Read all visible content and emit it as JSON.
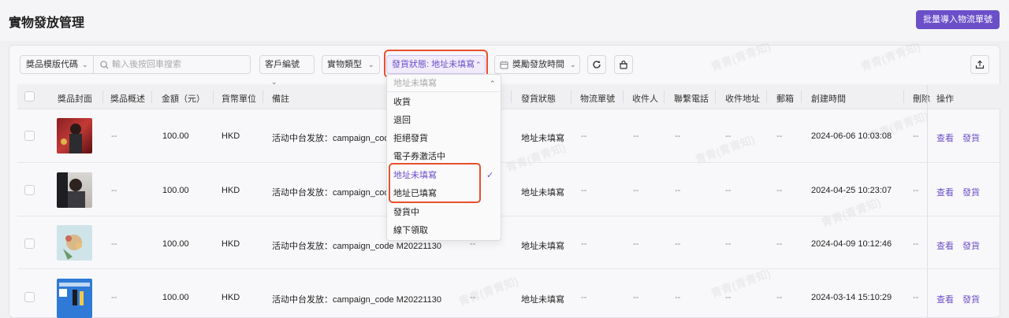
{
  "page": {
    "title": "實物發放管理",
    "batch_button": "批量導入物流單號"
  },
  "filters": {
    "search_field": "獎品模版代碼",
    "search_placeholder": "輸入後按回車搜索",
    "customer_code": "客戶編號",
    "item_type": "實物類型",
    "status": "發貨狀態: 地址未填寫",
    "reward_time": "獎勵發放時間"
  },
  "columns": [
    "獎品封面",
    "獎品概述",
    "金額（元）",
    "貨幣單位",
    "備註",
    "發貨狀態",
    "物流單號",
    "收件人",
    "聯繫電話",
    "收件地址",
    "郵箱",
    "創建時間",
    "刪除",
    "操作"
  ],
  "rows": [
    {
      "summary": "--",
      "amount": "100.00",
      "currency": "HKD",
      "remark": "活动中台发放：campaign_code",
      "status": "地址未填寫",
      "tracking": "--",
      "recipient": "--",
      "phone": "--",
      "address": "--",
      "email": "--",
      "created": "2024-06-06 10:03:08",
      "deleted": "--",
      "view": "查看",
      "ship": "發貨"
    },
    {
      "summary": "--",
      "amount": "100.00",
      "currency": "HKD",
      "remark": "活动中台发放：campaign_code",
      "status": "地址未填寫",
      "tracking": "--",
      "recipient": "--",
      "phone": "--",
      "address": "--",
      "email": "--",
      "created": "2024-04-25 10:23:07",
      "deleted": "--",
      "view": "查看",
      "ship": "發貨"
    },
    {
      "summary": "--",
      "amount": "100.00",
      "currency": "HKD",
      "remark": "活动中台发放：campaign_code M20221130",
      "col_mid": "--",
      "status": "地址未填寫",
      "tracking": "--",
      "recipient": "--",
      "phone": "--",
      "address": "--",
      "email": "--",
      "created": "2024-04-09 10:12:46",
      "deleted": "--",
      "view": "查看",
      "ship": "發貨"
    },
    {
      "summary": "--",
      "amount": "100.00",
      "currency": "HKD",
      "remark": "活动中台发放：campaign_code M20221130",
      "col_mid": "--",
      "status": "地址未填寫",
      "tracking": "--",
      "recipient": "--",
      "phone": "--",
      "address": "--",
      "email": "--",
      "created": "2024-03-14 15:10:29",
      "deleted": "--",
      "view": "查看",
      "ship": "發貨"
    }
  ],
  "dropdown": {
    "search_value": "地址未填寫",
    "options": [
      "收貨",
      "退回",
      "拒絕發貨",
      "電子券激活中",
      "地址未填寫",
      "地址已填寫",
      "發貨中",
      "線下領取"
    ],
    "selected": "地址未填寫"
  },
  "watermark": "青青(青青知)",
  "colors": {
    "accent": "#6b4fc8",
    "highlight": "#e8502c"
  }
}
